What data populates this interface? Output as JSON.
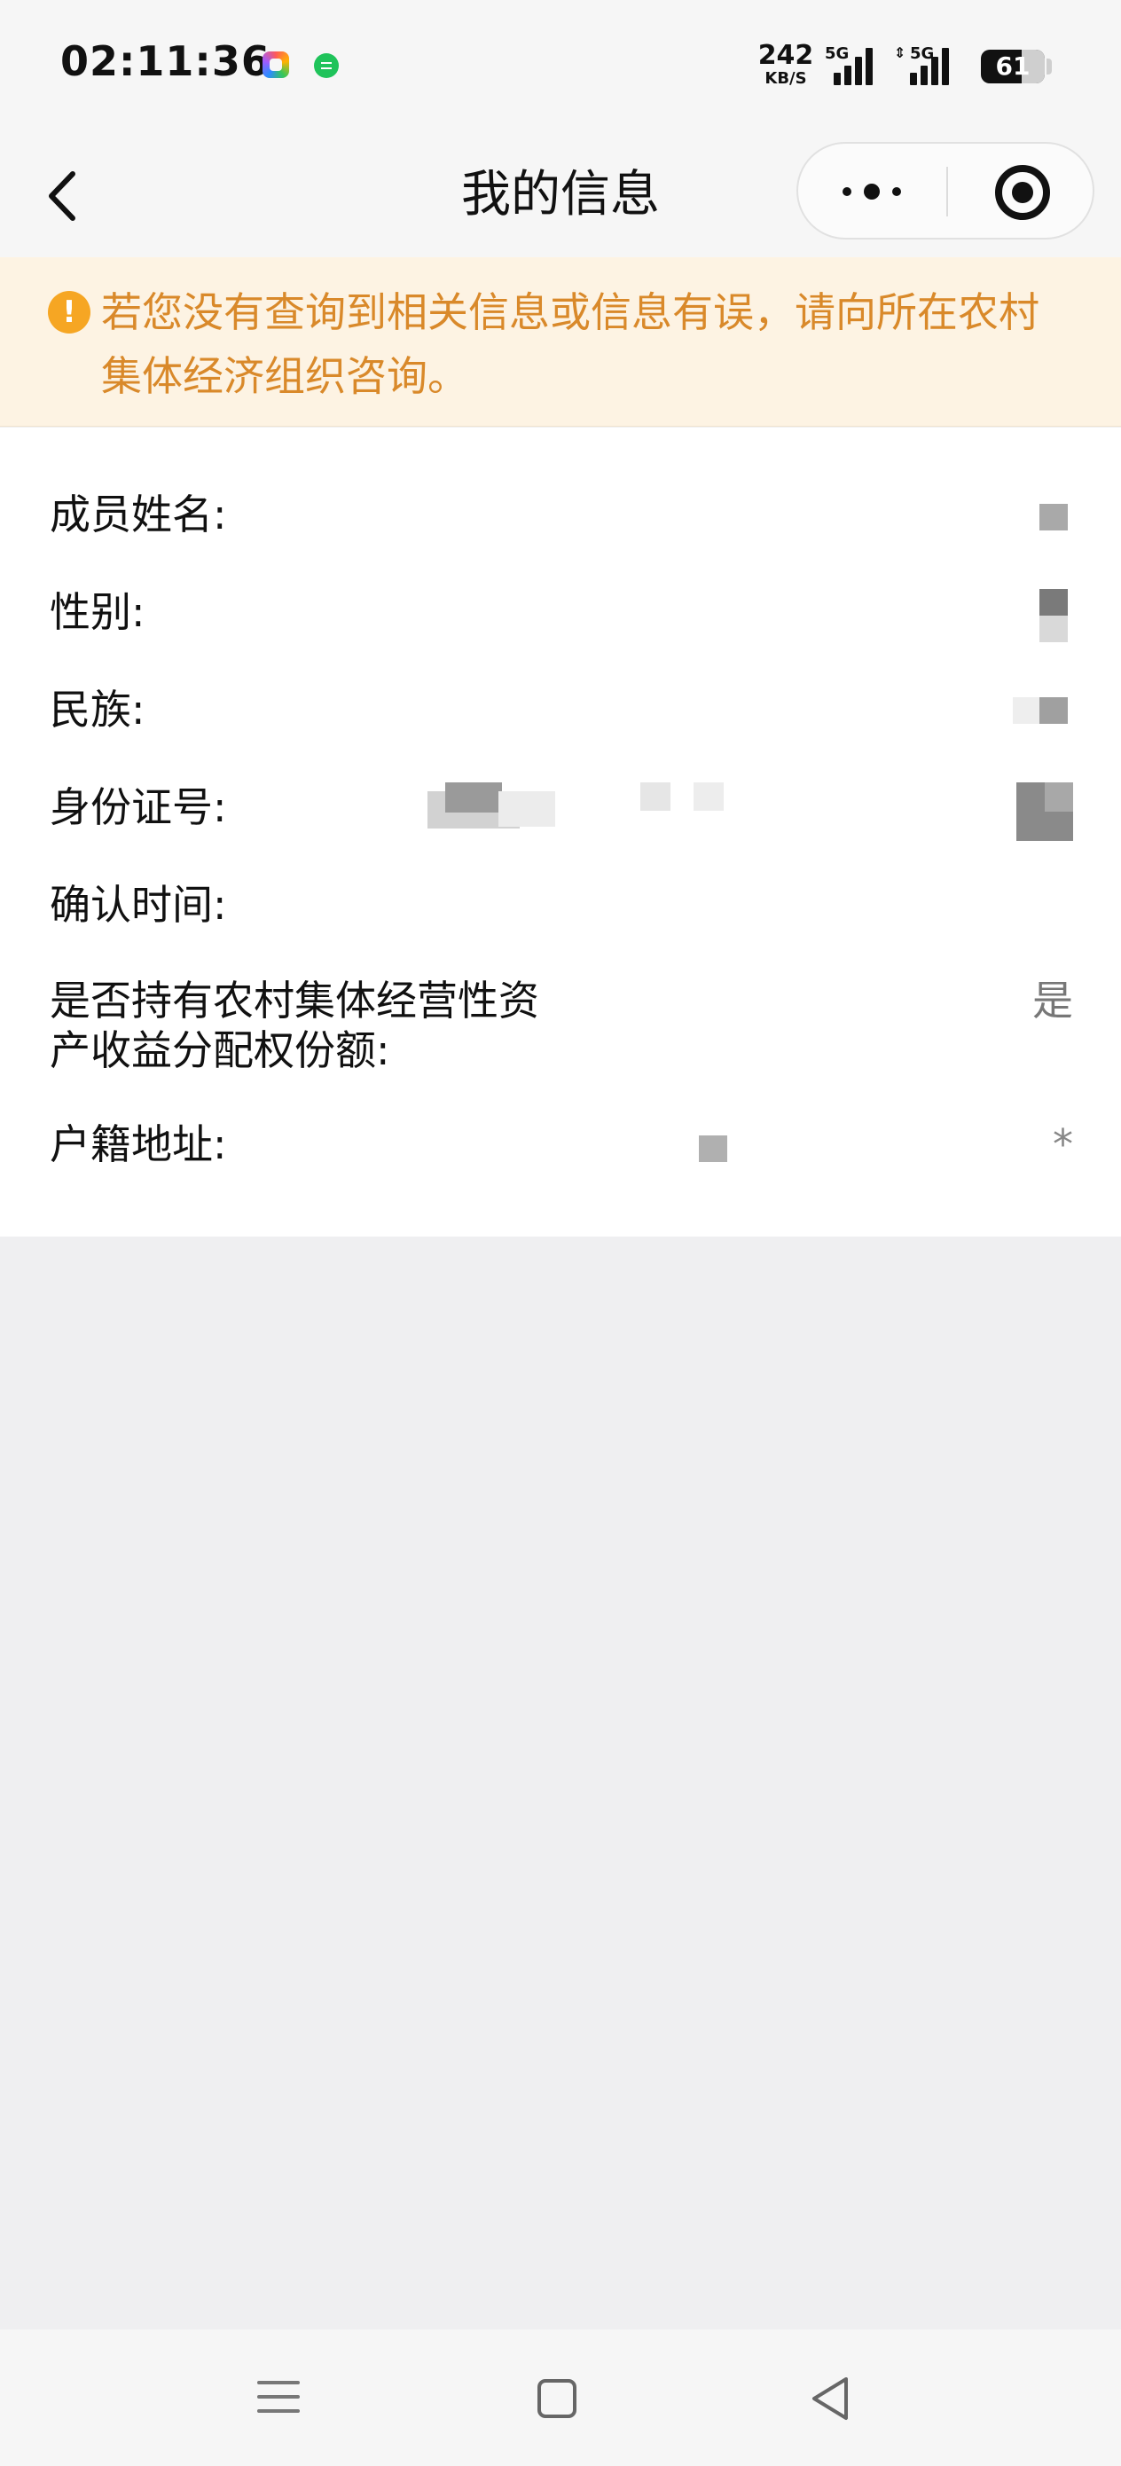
{
  "status_bar": {
    "time": "02:11:36",
    "net_speed_value": "242",
    "net_speed_unit": "KB/S",
    "sim1_label": "5G",
    "sim2_label": "5G",
    "battery_percent": "61"
  },
  "nav": {
    "title": "我的信息"
  },
  "notice": {
    "text": "若您没有查询到相关信息或信息有误，请向所在农村集体经济组织咨询。"
  },
  "info": {
    "name_label": "成员姓名:",
    "gender_label": "性别:",
    "ethnicity_label": "民族:",
    "id_label": "身份证号:",
    "confirm_time_label": "确认时间:",
    "share_label": "是否持有农村集体经营性资产收益分配权份额:",
    "share_value": "是",
    "address_label": "户籍地址:",
    "address_value": "*"
  },
  "colors": {
    "notice_bg": "#fdf3e3",
    "notice_text": "#d9892a",
    "notice_icon": "#f6a623",
    "page_bg": "#efeff1"
  }
}
